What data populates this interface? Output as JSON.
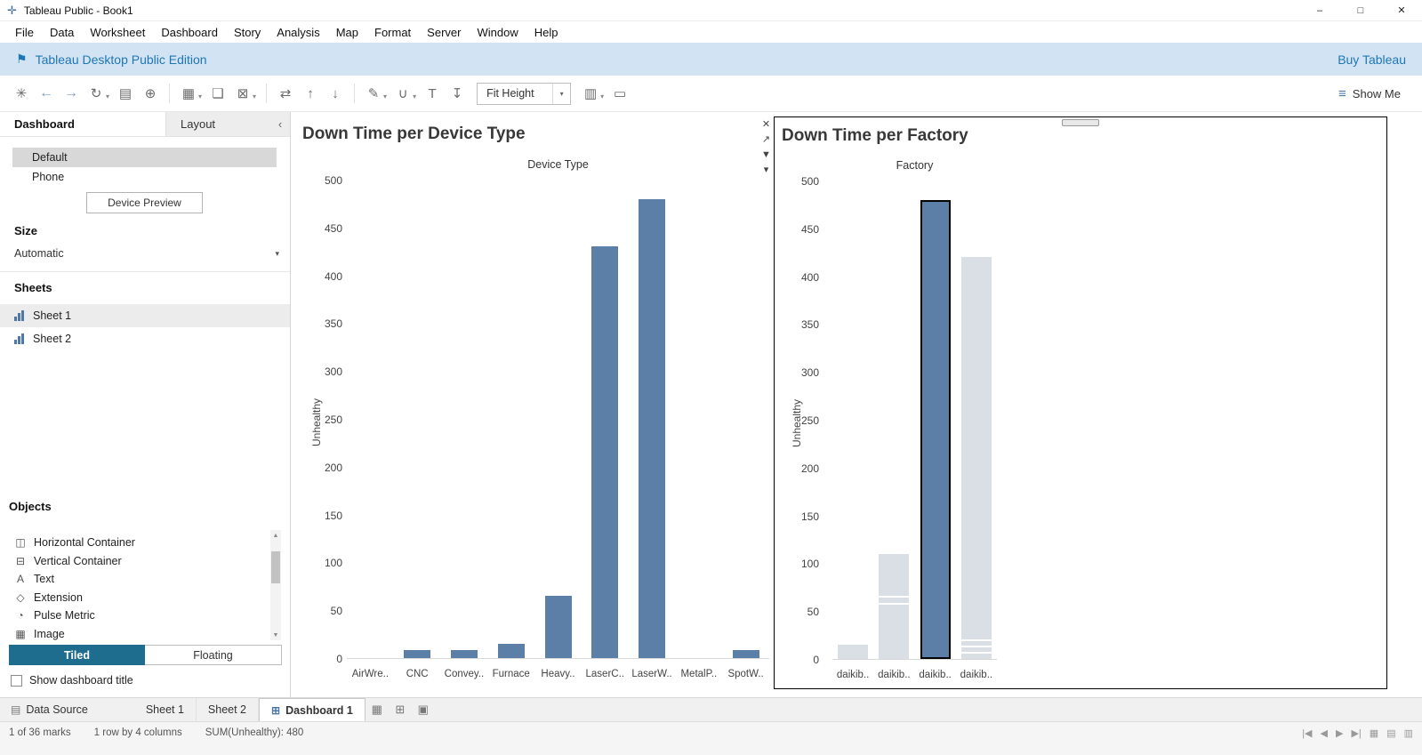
{
  "window": {
    "title": "Tableau Public - Book1",
    "minimize": "–",
    "maximize": "□",
    "close": "✕",
    "logo": "✛"
  },
  "menu": {
    "items": [
      "File",
      "Data",
      "Worksheet",
      "Dashboard",
      "Story",
      "Analysis",
      "Map",
      "Format",
      "Server",
      "Window",
      "Help"
    ]
  },
  "banner": {
    "icon": "⚑",
    "message": "Tableau Desktop Public Edition",
    "action": "Buy Tableau"
  },
  "toolbar": {
    "caret": "▾",
    "fit_value": "Fit Height",
    "show_me": "Show Me",
    "show_me_icon": "≡",
    "icons": [
      {
        "name": "start-page",
        "glyph": "✳"
      },
      {
        "name": "undo",
        "glyph": "←"
      },
      {
        "name": "redo",
        "glyph": "→"
      },
      {
        "name": "replay",
        "glyph": "↻"
      },
      {
        "name": "save",
        "glyph": "▤"
      },
      {
        "name": "new-data-source",
        "glyph": "⊕"
      },
      {
        "name": "new-worksheet",
        "glyph": "▦"
      },
      {
        "name": "duplicate",
        "glyph": "❏"
      },
      {
        "name": "clear-sheet",
        "glyph": "⊠"
      },
      {
        "name": "swap-rows-columns",
        "glyph": "⇄"
      },
      {
        "name": "sort-ascending",
        "glyph": "↑"
      },
      {
        "name": "sort-descending",
        "glyph": "↓"
      },
      {
        "name": "highlight",
        "glyph": "✎"
      },
      {
        "name": "group-members",
        "glyph": "∪"
      },
      {
        "name": "text-label",
        "glyph": "T"
      },
      {
        "name": "fix-axes",
        "glyph": "↧"
      },
      {
        "name": "show-cards",
        "glyph": "▥"
      },
      {
        "name": "presentation-mode",
        "glyph": "▭"
      }
    ]
  },
  "sidebar": {
    "tab_dashboard": "Dashboard",
    "tab_layout": "Layout",
    "collapse_icon": "‹",
    "device_modes": [
      {
        "label": "Default"
      },
      {
        "label": "Phone"
      }
    ],
    "device_preview_button": "Device Preview",
    "size": {
      "label": "Size",
      "value": "Automatic",
      "caret": "▾"
    },
    "sheets": {
      "label": "Sheets",
      "items": [
        "Sheet 1",
        "Sheet 2"
      ]
    },
    "objects": {
      "label": "Objects",
      "items": [
        {
          "label": "Horizontal Container",
          "icon": "◫"
        },
        {
          "label": "Vertical Container",
          "icon": "⊟"
        },
        {
          "label": "Text",
          "icon": "A"
        },
        {
          "label": "Extension",
          "icon": "◇"
        },
        {
          "label": "Pulse Metric",
          "icon": "◔"
        },
        {
          "label": "Image",
          "icon": "▦"
        }
      ],
      "scroll_up": "▲",
      "scroll_down": "▼"
    },
    "layout_mode": {
      "tiled": "Tiled",
      "floating": "Floating",
      "active": "Tiled"
    },
    "show_dashboard_title": "Show dashboard title"
  },
  "floating_controls": {
    "close": "✕",
    "go_to_sheet": "↗",
    "filter": "▼",
    "menu": "▾"
  },
  "chart_data": [
    {
      "type": "bar",
      "title": "Down Time per Device Type",
      "column_header": "Device Type",
      "ylabel": "Unhealthy",
      "ylim": [
        0,
        500
      ],
      "yticks": [
        0,
        50,
        100,
        150,
        200,
        250,
        300,
        350,
        400,
        450,
        500
      ],
      "categories": [
        "AirWre..",
        "CNC",
        "Convey..",
        "Furnace",
        "Heavy..",
        "LaserC..",
        "LaserW..",
        "MetalP..",
        "SpotW.."
      ],
      "values": [
        0,
        8,
        8,
        15,
        65,
        430,
        480,
        0,
        8
      ],
      "bar_color": "#5b7fa6",
      "grid": false,
      "legend": false
    },
    {
      "type": "bar",
      "title": "Down Time per Factory",
      "column_header": "Factory",
      "ylabel": "Unhealthy",
      "ylim": [
        0,
        500
      ],
      "yticks": [
        0,
        50,
        100,
        150,
        200,
        250,
        300,
        350,
        400,
        450,
        500
      ],
      "categories": [
        "daikib..",
        "daikib..",
        "daikib..",
        "daikib.."
      ],
      "values": [
        15,
        110,
        480,
        420
      ],
      "selected_index": 2,
      "bar_color": "#5b7fa6",
      "unselected_color": "#d9dfe5",
      "selection_border": "#000000",
      "mark_dividers": [
        [],
        [
          57,
          64
        ],
        [],
        [
          6,
          12,
          19
        ]
      ],
      "grid": false,
      "legend": false
    }
  ],
  "tab_strip": {
    "data_source": "Data Source",
    "data_source_icon": "▤",
    "dashboard_tab_icon": "⊞",
    "tabs": [
      {
        "label": "Sheet 1",
        "active": false
      },
      {
        "label": "Sheet 2",
        "active": false
      },
      {
        "label": "Dashboard 1",
        "active": true
      }
    ],
    "new_worksheet_icon": "▦",
    "new_dashboard_icon": "⊞",
    "new_story_icon": "▣"
  },
  "status_bar": {
    "marks": "1 of 36 marks",
    "dimensions": "1 row by 4 columns",
    "aggregate": "SUM(Unhealthy): 480",
    "nav_icons": [
      "|◀",
      "◀",
      "▶",
      "▶|"
    ],
    "view_icons": [
      "▦",
      "▤",
      "▥"
    ]
  }
}
